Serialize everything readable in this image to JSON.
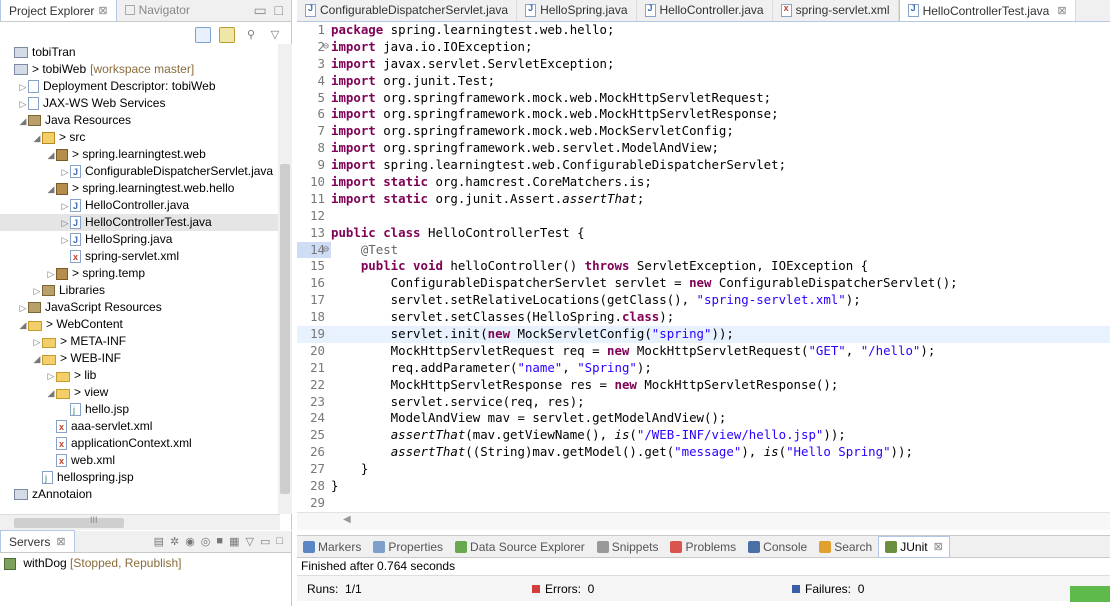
{
  "left": {
    "tabs": [
      {
        "label": "Project Explorer",
        "active": true,
        "close": "⊠"
      },
      {
        "label": "Navigator",
        "active": false
      }
    ],
    "tree": [
      {
        "id": "tobiTran",
        "label": "tobiTran",
        "indent": 0,
        "arrow": "",
        "icon": "project",
        "decor": ""
      },
      {
        "id": "tobiWeb",
        "label": "> tobiWeb",
        "indent": 0,
        "arrow": "",
        "icon": "project",
        "decor": "[workspace master]"
      },
      {
        "id": "deploy",
        "label": "Deployment Descriptor: tobiWeb",
        "indent": 1,
        "arrow": "▷",
        "icon": "file",
        "decor": ""
      },
      {
        "id": "jaxws",
        "label": "JAX-WS Web Services",
        "indent": 1,
        "arrow": "▷",
        "icon": "file",
        "decor": ""
      },
      {
        "id": "javares",
        "label": "Java Resources",
        "indent": 1,
        "arrow": "◢",
        "icon": "lib",
        "decor": ""
      },
      {
        "id": "src",
        "label": "> src",
        "indent": 2,
        "arrow": "◢",
        "icon": "src",
        "decor": ""
      },
      {
        "id": "pkg1",
        "label": "> spring.learningtest.web",
        "indent": 3,
        "arrow": "◢",
        "icon": "pkg",
        "decor": ""
      },
      {
        "id": "cds",
        "label": "ConfigurableDispatcherServlet.java",
        "indent": 4,
        "arrow": "▷",
        "icon": "java",
        "decor": ""
      },
      {
        "id": "pkg2",
        "label": "> spring.learningtest.web.hello",
        "indent": 3,
        "arrow": "◢",
        "icon": "pkg",
        "decor": ""
      },
      {
        "id": "hc",
        "label": "HelloController.java",
        "indent": 4,
        "arrow": "▷",
        "icon": "java",
        "decor": ""
      },
      {
        "id": "hct",
        "label": "HelloControllerTest.java",
        "indent": 4,
        "arrow": "▷",
        "icon": "java",
        "decor": "",
        "selected": true
      },
      {
        "id": "hs",
        "label": "HelloSpring.java",
        "indent": 4,
        "arrow": "▷",
        "icon": "java",
        "decor": ""
      },
      {
        "id": "ssx",
        "label": "spring-servlet.xml",
        "indent": 4,
        "arrow": "",
        "icon": "xml",
        "decor": ""
      },
      {
        "id": "temp",
        "label": "> spring.temp",
        "indent": 3,
        "arrow": "▷",
        "icon": "pkg",
        "decor": ""
      },
      {
        "id": "libs",
        "label": "Libraries",
        "indent": 2,
        "arrow": "▷",
        "icon": "lib",
        "decor": ""
      },
      {
        "id": "jsres",
        "label": "JavaScript Resources",
        "indent": 1,
        "arrow": "▷",
        "icon": "lib",
        "decor": ""
      },
      {
        "id": "webc",
        "label": "> WebContent",
        "indent": 1,
        "arrow": "◢",
        "icon": "folder",
        "decor": ""
      },
      {
        "id": "meta",
        "label": "> META-INF",
        "indent": 2,
        "arrow": "▷",
        "icon": "folder",
        "decor": ""
      },
      {
        "id": "webinf",
        "label": "> WEB-INF",
        "indent": 2,
        "arrow": "◢",
        "icon": "folder",
        "decor": ""
      },
      {
        "id": "lib",
        "label": "> lib",
        "indent": 3,
        "arrow": "▷",
        "icon": "folder",
        "decor": ""
      },
      {
        "id": "view",
        "label": "> view",
        "indent": 3,
        "arrow": "◢",
        "icon": "folder",
        "decor": ""
      },
      {
        "id": "hellojsp",
        "label": "hello.jsp",
        "indent": 4,
        "arrow": "",
        "icon": "jsp",
        "decor": ""
      },
      {
        "id": "aaa",
        "label": "aaa-servlet.xml",
        "indent": 3,
        "arrow": "",
        "icon": "xml",
        "decor": ""
      },
      {
        "id": "appctx",
        "label": "applicationContext.xml",
        "indent": 3,
        "arrow": "",
        "icon": "xml",
        "decor": ""
      },
      {
        "id": "webxml",
        "label": "web.xml",
        "indent": 3,
        "arrow": "",
        "icon": "xml",
        "decor": ""
      },
      {
        "id": "hellospring",
        "label": "hellospring.jsp",
        "indent": 2,
        "arrow": "",
        "icon": "jsp",
        "decor": ""
      },
      {
        "id": "zann",
        "label": "zAnnotaion",
        "indent": 0,
        "arrow": "",
        "icon": "project",
        "decor": ""
      }
    ],
    "hscroll_label": "III"
  },
  "servers": {
    "tab_label": "Servers",
    "tab_close": "⊠",
    "item_label": "withDog",
    "item_status": "[Stopped, Republish]"
  },
  "editor": {
    "tabs": [
      {
        "label": "ConfigurableDispatcherServlet.java",
        "icon": "java",
        "active": false
      },
      {
        "label": "HelloSpring.java",
        "icon": "java",
        "active": false
      },
      {
        "label": "HelloController.java",
        "icon": "java",
        "active": false
      },
      {
        "label": "spring-servlet.xml",
        "icon": "xml",
        "active": false
      },
      {
        "label": "HelloControllerTest.java",
        "icon": "java",
        "active": true,
        "close": "⊠"
      }
    ],
    "lines": [
      {
        "n": "1",
        "marker": "",
        "tokens": [
          [
            "kw",
            "package"
          ],
          [
            "t",
            " spring.learningtest.web.hello;"
          ]
        ]
      },
      {
        "n": "2",
        "marker": "⊖",
        "tokens": [
          [
            "kw",
            "import"
          ],
          [
            "t",
            " java.io.IOException;"
          ]
        ]
      },
      {
        "n": "3",
        "marker": "",
        "tokens": [
          [
            "kw",
            "import"
          ],
          [
            "t",
            " javax.servlet.ServletException;"
          ]
        ]
      },
      {
        "n": "4",
        "marker": "",
        "tokens": [
          [
            "kw",
            "import"
          ],
          [
            "t",
            " org.junit.Test;"
          ]
        ]
      },
      {
        "n": "5",
        "marker": "",
        "tokens": [
          [
            "kw",
            "import"
          ],
          [
            "t",
            " org.springframework.mock.web.MockHttpServletRequest;"
          ]
        ]
      },
      {
        "n": "6",
        "marker": "",
        "tokens": [
          [
            "kw",
            "import"
          ],
          [
            "t",
            " org.springframework.mock.web.MockHttpServletResponse;"
          ]
        ]
      },
      {
        "n": "7",
        "marker": "",
        "tokens": [
          [
            "kw",
            "import"
          ],
          [
            "t",
            " org.springframework.mock.web.MockServletConfig;"
          ]
        ]
      },
      {
        "n": "8",
        "marker": "",
        "tokens": [
          [
            "kw",
            "import"
          ],
          [
            "t",
            " org.springframework.web.servlet.ModelAndView;"
          ]
        ]
      },
      {
        "n": "9",
        "marker": "",
        "tokens": [
          [
            "kw",
            "import"
          ],
          [
            "t",
            " spring.learningtest.web.ConfigurableDispatcherServlet;"
          ]
        ]
      },
      {
        "n": "10",
        "marker": "",
        "tokens": [
          [
            "kw",
            "import static"
          ],
          [
            "t",
            " org.hamcrest.CoreMatchers.is;"
          ]
        ]
      },
      {
        "n": "11",
        "marker": "",
        "tokens": [
          [
            "kw",
            "import static"
          ],
          [
            "t",
            " org.junit.Assert."
          ],
          [
            "ital",
            "assertThat"
          ],
          [
            "t",
            ";"
          ]
        ]
      },
      {
        "n": "12",
        "marker": "",
        "tokens": []
      },
      {
        "n": "13",
        "marker": "",
        "tokens": [
          [
            "kw",
            "public class"
          ],
          [
            "t",
            " HelloControllerTest {"
          ]
        ]
      },
      {
        "n": "14",
        "marker": "⊖",
        "tokens": [
          [
            "t",
            "    "
          ],
          [
            "ann",
            "@Test"
          ]
        ]
      },
      {
        "n": "15",
        "marker": "",
        "tokens": [
          [
            "t",
            "    "
          ],
          [
            "kw",
            "public void"
          ],
          [
            "t",
            " helloController() "
          ],
          [
            "kw",
            "throws"
          ],
          [
            "t",
            " ServletException, IOException {"
          ]
        ]
      },
      {
        "n": "16",
        "marker": "",
        "tokens": [
          [
            "t",
            "        ConfigurableDispatcherServlet servlet = "
          ],
          [
            "kw",
            "new"
          ],
          [
            "t",
            " ConfigurableDispatcherServlet();"
          ]
        ]
      },
      {
        "n": "17",
        "marker": "",
        "tokens": [
          [
            "t",
            "        servlet.setRelativeLocations(getClass(), "
          ],
          [
            "str",
            "\"spring-servlet.xml\""
          ],
          [
            "t",
            ");"
          ]
        ]
      },
      {
        "n": "18",
        "marker": "",
        "tokens": [
          [
            "t",
            "        servlet.setClasses(HelloSpring."
          ],
          [
            "kw",
            "class"
          ],
          [
            "t",
            ");"
          ]
        ]
      },
      {
        "n": "19",
        "marker": "",
        "current": true,
        "tokens": [
          [
            "t",
            "        servlet.init("
          ],
          [
            "kw",
            "new"
          ],
          [
            "t",
            " MockServletConfig("
          ],
          [
            "str",
            "\"spring\""
          ],
          [
            "t",
            "));"
          ]
        ]
      },
      {
        "n": "20",
        "marker": "",
        "tokens": [
          [
            "t",
            "        MockHttpServletRequest req = "
          ],
          [
            "kw",
            "new"
          ],
          [
            "t",
            " MockHttpServletRequest("
          ],
          [
            "str",
            "\"GET\""
          ],
          [
            "t",
            ", "
          ],
          [
            "str",
            "\"/hello\""
          ],
          [
            "t",
            ");"
          ]
        ]
      },
      {
        "n": "21",
        "marker": "",
        "tokens": [
          [
            "t",
            "        req.addParameter("
          ],
          [
            "str",
            "\"name\""
          ],
          [
            "t",
            ", "
          ],
          [
            "str",
            "\"Spring\""
          ],
          [
            "t",
            ");"
          ]
        ]
      },
      {
        "n": "22",
        "marker": "",
        "tokens": [
          [
            "t",
            "        MockHttpServletResponse res = "
          ],
          [
            "kw",
            "new"
          ],
          [
            "t",
            " MockHttpServletResponse();"
          ]
        ]
      },
      {
        "n": "23",
        "marker": "",
        "tokens": [
          [
            "t",
            "        servlet.service(req, res);"
          ]
        ]
      },
      {
        "n": "24",
        "marker": "",
        "tokens": [
          [
            "t",
            "        ModelAndView mav = servlet.getModelAndView();"
          ]
        ]
      },
      {
        "n": "25",
        "marker": "",
        "tokens": [
          [
            "t",
            "        "
          ],
          [
            "ital",
            "assertThat"
          ],
          [
            "t",
            "(mav.getViewName(), "
          ],
          [
            "ital",
            "is"
          ],
          [
            "t",
            "("
          ],
          [
            "str",
            "\"/WEB-INF/view/hello.jsp\""
          ],
          [
            "t",
            "));"
          ]
        ]
      },
      {
        "n": "26",
        "marker": "",
        "tokens": [
          [
            "t",
            "        "
          ],
          [
            "ital",
            "assertThat"
          ],
          [
            "t",
            "((String)mav.getModel().get("
          ],
          [
            "str",
            "\"message\""
          ],
          [
            "t",
            "), "
          ],
          [
            "ital",
            "is"
          ],
          [
            "t",
            "("
          ],
          [
            "str",
            "\"Hello Spring\""
          ],
          [
            "t",
            "));"
          ]
        ]
      },
      {
        "n": "27",
        "marker": "",
        "tokens": [
          [
            "t",
            "    }"
          ]
        ]
      },
      {
        "n": "28",
        "marker": "",
        "tokens": [
          [
            "t",
            "}"
          ]
        ]
      },
      {
        "n": "29",
        "marker": "",
        "tokens": []
      }
    ]
  },
  "bottom": {
    "tabs": [
      {
        "label": "Markers",
        "color": "#5b86c5",
        "active": false
      },
      {
        "label": "Properties",
        "color": "#7e9fc9",
        "active": false
      },
      {
        "label": "Data Source Explorer",
        "color": "#6aa84f",
        "active": false
      },
      {
        "label": "Snippets",
        "color": "#999999",
        "active": false
      },
      {
        "label": "Problems",
        "color": "#d9534f",
        "active": false
      },
      {
        "label": "Console",
        "color": "#4a6fa5",
        "active": false
      },
      {
        "label": "Search",
        "color": "#e0a030",
        "active": false
      },
      {
        "label": "JUnit",
        "color": "#6a8f3f",
        "active": true,
        "close": "⊠"
      }
    ],
    "finished_text": "Finished after 0.764 seconds",
    "runs_label": "Runs:",
    "runs_value": "1/1",
    "errors_label": "Errors:",
    "errors_value": "0",
    "failures_label": "Failures:",
    "failures_value": "0",
    "progress_color": "#5fba4c"
  }
}
